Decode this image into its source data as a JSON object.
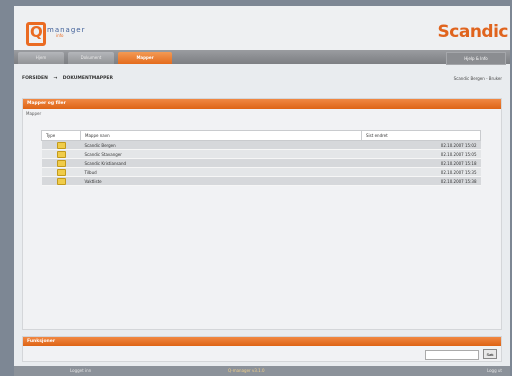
{
  "header": {
    "logo_letter": "Q",
    "logo_text": "manager",
    "logo_sub": "info",
    "brand": "Scandic"
  },
  "tabs": [
    {
      "label": "Hjem"
    },
    {
      "label": "Dokument"
    },
    {
      "label": "Mapper"
    }
  ],
  "topright_label": "Hjelp & Info",
  "breadcrumb": {
    "items": [
      "FORSIDEN",
      "→",
      "DOKUMENTMAPPER"
    ]
  },
  "user": {
    "name": "Scandic Bergen",
    "sep": "-",
    "role": "Bruker"
  },
  "panel": {
    "title": "Mapper og filer",
    "subtitle": "Mapper"
  },
  "table": {
    "headers": [
      "Type",
      "Mappe navn",
      "Sist endret"
    ],
    "rows": [
      {
        "name": "Scandic Bergen",
        "date": "02.10.2007 15:02"
      },
      {
        "name": "Scandic Stavanger",
        "date": "02.10.2007 15:05"
      },
      {
        "name": "Scandic Kristiansand",
        "date": "02.10.2007 15:18"
      },
      {
        "name": "Tilbud",
        "date": "02.10.2007 15:35"
      },
      {
        "name": "Vaktliste",
        "date": "02.10.2007 15:38"
      }
    ]
  },
  "footer": {
    "title": "Funksjoner",
    "button": "Søk"
  },
  "status": {
    "left": "Logget inn",
    "center": "Q-manager v3.1.0",
    "right": "Logg ut"
  },
  "colors": {
    "accent": "#e46b1d",
    "brand": "#e0641e",
    "logo_text": "#3f5f98"
  }
}
